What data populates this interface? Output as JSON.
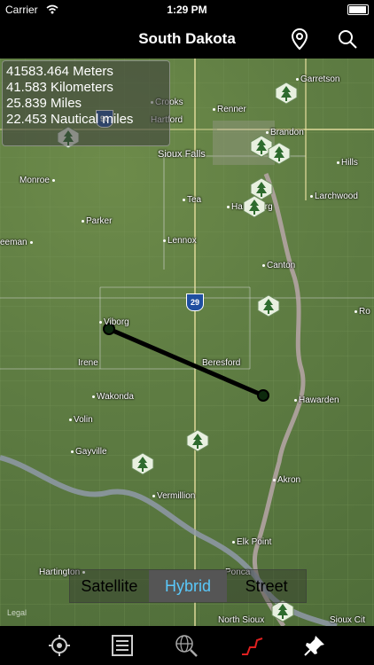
{
  "status": {
    "carrier": "Carrier",
    "time": "1:29 PM"
  },
  "nav": {
    "title": "South Dakota",
    "pin_icon": "map-pin-icon",
    "search_icon": "search-icon"
  },
  "measure": {
    "meters": "41583.464 Meters",
    "kilometers": "41.583 Kilometers",
    "miles": "25.839 Miles",
    "nautical": "22.453 Nautical miles"
  },
  "map_labels": {
    "garretson": "Garretson",
    "crooks": "Crooks",
    "renner": "Renner",
    "brandon": "Brandon",
    "hartford": "Hartford",
    "sioux_falls": "Sioux Falls",
    "hills": "Hills",
    "monroe": "Monroe",
    "tea": "Tea",
    "harrisburg": "Harrisburg",
    "larchwood": "Larchwood",
    "parker": "Parker",
    "freeman": "eeman",
    "lennox": "Lennox",
    "canton": "Canton",
    "rock": "Ro",
    "viborg": "Viborg",
    "irene": "Irene",
    "beresford": "Beresford",
    "wakonda": "Wakonda",
    "hawarden": "Hawarden",
    "volin": "Volin",
    "gayville": "Gayville",
    "akron": "Akron",
    "vermillion": "Vermillion",
    "elk_point": "Elk Point",
    "hartington": "Hartington",
    "ponca": "Ponca",
    "north_sioux": "North Sioux",
    "sioux_city": "Sioux Cit",
    "shield_29": "29",
    "shield_90": "90"
  },
  "map_type": {
    "satellite": "Satellite",
    "hybrid": "Hybrid",
    "street": "Street",
    "selected": "Hybrid"
  },
  "legal": "Legal",
  "tabs": [
    {
      "icon": "locate-icon"
    },
    {
      "icon": "list-icon"
    },
    {
      "icon": "globe-search-icon"
    },
    {
      "icon": "measure-path-icon",
      "color": "#e02020"
    },
    {
      "icon": "pushpin-icon"
    }
  ],
  "colors": {
    "accent_blue": "#5ac8fa",
    "route_line": "#000000",
    "tab_active": "#e02020"
  }
}
